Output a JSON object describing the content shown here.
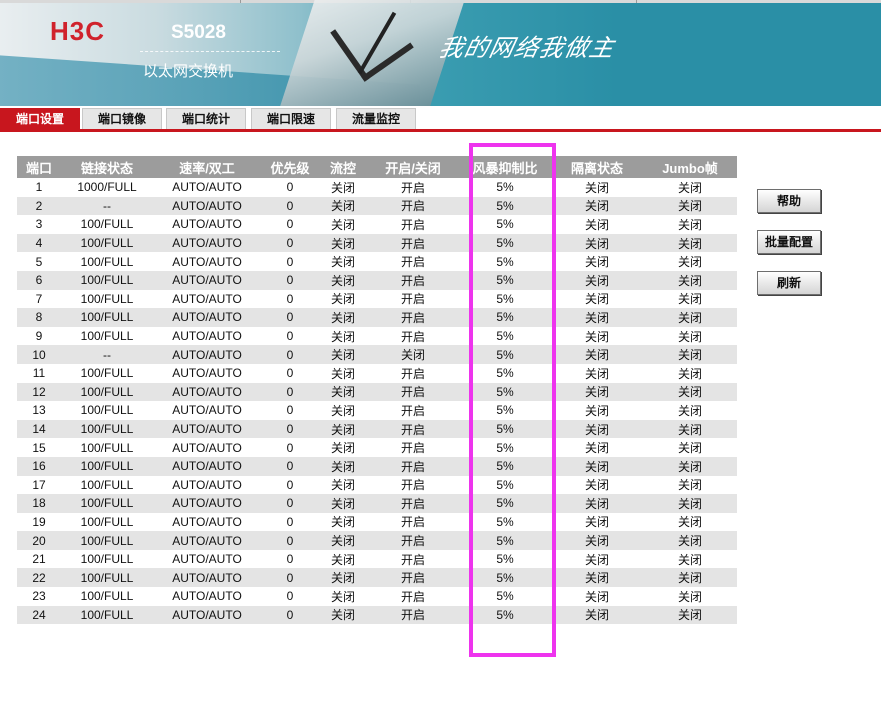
{
  "header": {
    "logo": "H3C",
    "model": "S5028",
    "subtitle": "以太网交换机",
    "slogan": "我的网络我做主"
  },
  "tabs": [
    {
      "label": "端口设置",
      "active": true
    },
    {
      "label": "端口镜像",
      "active": false
    },
    {
      "label": "端口统计",
      "active": false
    },
    {
      "label": "端口限速",
      "active": false
    },
    {
      "label": "流量监控",
      "active": false
    }
  ],
  "table": {
    "headers": [
      "端口",
      "链接状态",
      "速率/双工",
      "优先级",
      "流控",
      "开启/关闭",
      "风暴抑制比",
      "隔离状态",
      "Jumbo帧"
    ],
    "rows": [
      [
        "1",
        "1000/FULL",
        "AUTO/AUTO",
        "0",
        "关闭",
        "开启",
        "5%",
        "关闭",
        "关闭"
      ],
      [
        "2",
        "--",
        "AUTO/AUTO",
        "0",
        "关闭",
        "开启",
        "5%",
        "关闭",
        "关闭"
      ],
      [
        "3",
        "100/FULL",
        "AUTO/AUTO",
        "0",
        "关闭",
        "开启",
        "5%",
        "关闭",
        "关闭"
      ],
      [
        "4",
        "100/FULL",
        "AUTO/AUTO",
        "0",
        "关闭",
        "开启",
        "5%",
        "关闭",
        "关闭"
      ],
      [
        "5",
        "100/FULL",
        "AUTO/AUTO",
        "0",
        "关闭",
        "开启",
        "5%",
        "关闭",
        "关闭"
      ],
      [
        "6",
        "100/FULL",
        "AUTO/AUTO",
        "0",
        "关闭",
        "开启",
        "5%",
        "关闭",
        "关闭"
      ],
      [
        "7",
        "100/FULL",
        "AUTO/AUTO",
        "0",
        "关闭",
        "开启",
        "5%",
        "关闭",
        "关闭"
      ],
      [
        "8",
        "100/FULL",
        "AUTO/AUTO",
        "0",
        "关闭",
        "开启",
        "5%",
        "关闭",
        "关闭"
      ],
      [
        "9",
        "100/FULL",
        "AUTO/AUTO",
        "0",
        "关闭",
        "开启",
        "5%",
        "关闭",
        "关闭"
      ],
      [
        "10",
        "--",
        "AUTO/AUTO",
        "0",
        "关闭",
        "关闭",
        "5%",
        "关闭",
        "关闭"
      ],
      [
        "11",
        "100/FULL",
        "AUTO/AUTO",
        "0",
        "关闭",
        "开启",
        "5%",
        "关闭",
        "关闭"
      ],
      [
        "12",
        "100/FULL",
        "AUTO/AUTO",
        "0",
        "关闭",
        "开启",
        "5%",
        "关闭",
        "关闭"
      ],
      [
        "13",
        "100/FULL",
        "AUTO/AUTO",
        "0",
        "关闭",
        "开启",
        "5%",
        "关闭",
        "关闭"
      ],
      [
        "14",
        "100/FULL",
        "AUTO/AUTO",
        "0",
        "关闭",
        "开启",
        "5%",
        "关闭",
        "关闭"
      ],
      [
        "15",
        "100/FULL",
        "AUTO/AUTO",
        "0",
        "关闭",
        "开启",
        "5%",
        "关闭",
        "关闭"
      ],
      [
        "16",
        "100/FULL",
        "AUTO/AUTO",
        "0",
        "关闭",
        "开启",
        "5%",
        "关闭",
        "关闭"
      ],
      [
        "17",
        "100/FULL",
        "AUTO/AUTO",
        "0",
        "关闭",
        "开启",
        "5%",
        "关闭",
        "关闭"
      ],
      [
        "18",
        "100/FULL",
        "AUTO/AUTO",
        "0",
        "关闭",
        "开启",
        "5%",
        "关闭",
        "关闭"
      ],
      [
        "19",
        "100/FULL",
        "AUTO/AUTO",
        "0",
        "关闭",
        "开启",
        "5%",
        "关闭",
        "关闭"
      ],
      [
        "20",
        "100/FULL",
        "AUTO/AUTO",
        "0",
        "关闭",
        "开启",
        "5%",
        "关闭",
        "关闭"
      ],
      [
        "21",
        "100/FULL",
        "AUTO/AUTO",
        "0",
        "关闭",
        "开启",
        "5%",
        "关闭",
        "关闭"
      ],
      [
        "22",
        "100/FULL",
        "AUTO/AUTO",
        "0",
        "关闭",
        "开启",
        "5%",
        "关闭",
        "关闭"
      ],
      [
        "23",
        "100/FULL",
        "AUTO/AUTO",
        "0",
        "关闭",
        "开启",
        "5%",
        "关闭",
        "关闭"
      ],
      [
        "24",
        "100/FULL",
        "AUTO/AUTO",
        "0",
        "关闭",
        "开启",
        "5%",
        "关闭",
        "关闭"
      ]
    ]
  },
  "buttons": {
    "help": "帮助",
    "batch": "批量配置",
    "refresh": "刷新"
  },
  "colors": {
    "brand_red": "#c8161e",
    "header_gray": "#9c9c9c",
    "stripe_gray": "#e4e4e4",
    "highlight_magenta": "#ee33ee",
    "banner_teal": "#2a8fa6"
  }
}
